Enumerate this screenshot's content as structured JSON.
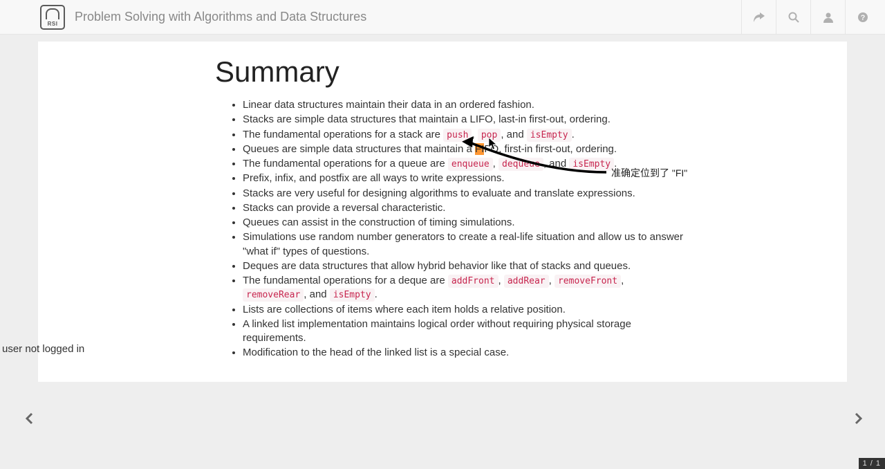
{
  "header": {
    "logo_text": "RSI",
    "site_title": "Problem Solving with Algorithms and Data Structures",
    "icons": {
      "share": "share-icon",
      "search": "search-icon",
      "user": "user-icon",
      "help": "help-icon"
    }
  },
  "content": {
    "heading": "Summary",
    "bullets": {
      "b0": "Linear data structures maintain their data in an ordered fashion.",
      "b1": "Stacks are simple data structures that maintain a LIFO, last-in first-out, ordering.",
      "b2_pre": "The fundamental operations for a stack are ",
      "b2_c1": "push",
      "b2_mid1": ", ",
      "b2_c2": "pop",
      "b2_mid2": ", and ",
      "b2_c3": "isEmpty",
      "b2_post": ".",
      "b3_pre": "Queues are simple data structures that maintain a ",
      "b3_hl": "FI",
      "b3_post": "FO, first-in first-out, ordering.",
      "b4_pre": "The fundamental operations for a queue are ",
      "b4_c1": "enqueue",
      "b4_mid1": ", ",
      "b4_c2": "dequeue",
      "b4_mid2": ", and ",
      "b4_c3": "isEmpty",
      "b4_post": ".",
      "b5": "Prefix, infix, and postfix are all ways to write expressions.",
      "b6": "Stacks are very useful for designing algorithms to evaluate and translate expressions.",
      "b7": "Stacks can provide a reversal characteristic.",
      "b8": "Queues can assist in the construction of timing simulations.",
      "b9": "Simulations use random number generators to create a real-life situation and allow us to answer \"what if\" types of questions.",
      "b10": "Deques are data structures that allow hybrid behavior like that of stacks and queues.",
      "b11_pre": "The fundamental operations for a deque are ",
      "b11_c1": "addFront",
      "b11_mid1": ", ",
      "b11_c2": "addRear",
      "b11_mid2": ", ",
      "b11_c3": "removeFront",
      "b11_mid3": ", ",
      "b11_c4": "removeRear",
      "b11_mid4": ", and ",
      "b11_c5": "isEmpty",
      "b11_post": ".",
      "b12": "Lists are collections of items where each item holds a relative position.",
      "b13": "A linked list implementation maintains logical order without requiring physical storage requirements.",
      "b14": "Modification to the head of the linked list is a special case."
    }
  },
  "annotation": {
    "label": "准确定位到了 \"FI\""
  },
  "footer": {
    "status": "user not logged in",
    "page_counter": "1 / 1"
  }
}
